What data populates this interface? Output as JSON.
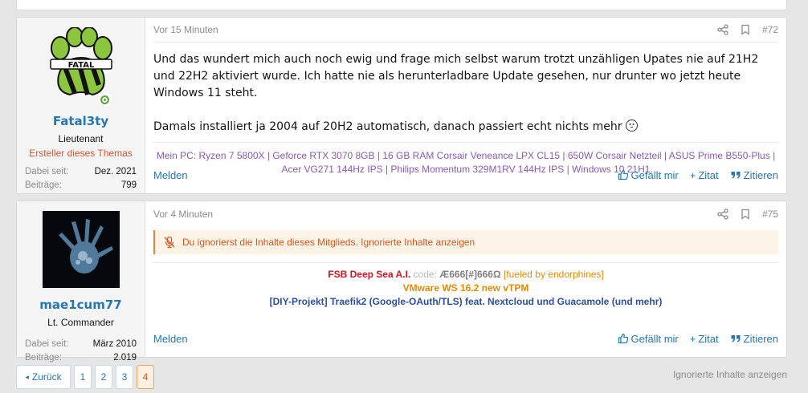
{
  "posts": [
    {
      "user": {
        "name": "Fatal3ty",
        "title": "Lieutenant",
        "banner": "Ersteller dieses Themas",
        "joined_label": "Dabei seit:",
        "joined_value": "Dez. 2021",
        "posts_label": "Beiträge:",
        "posts_value": "799",
        "online": true
      },
      "date": "Vor 15 Minuten",
      "number": "#72",
      "body": [
        "Und das wundert mich auch noch ewig und frage mich selbst warum trotzt unzähligen Upates nie auf 21H2 und 22H2 aktiviert wurde. Ich hatte nie als herunterladbare Update gesehen, nur drunter wo jetzt heute Windows 11 steht.",
        "Damals installiert ja 2004 auf 20H2 automatisch, danach passiert echt nichts mehr"
      ],
      "signature": "Mein PC: Ryzen 7 5800X | Geforce RTX 3070 8GB | 16 GB RAM Corsair Veneance LPX CL15 | 650W Corsair Netzteil | ASUS Prime B550-Plus | Acer VG271 144Hz IPS | Philips Momentum 329M1RV 144Hz IPS | Windows 10 21H1",
      "report": "Melden",
      "like": "Gefällt mir",
      "cite": "Zitat",
      "quote": "Zitieren"
    },
    {
      "user": {
        "name": "mae1cum77",
        "title": "Lt. Commander",
        "joined_label": "Dabei seit:",
        "joined_value": "März 2010",
        "posts_label": "Beiträge:",
        "posts_value": "2.019"
      },
      "date": "Vor 4 Minuten",
      "number": "#75",
      "ignore_text": "Du ignorierst die Inhalte dieses Mitglieds.",
      "ignore_link": "Ignorierte Inhalte anzeigen",
      "sig_line1_title": "FSB Deep Sea A.I.",
      "sig_line1_code_label": "code:",
      "sig_line1_code": "Æ666[#]666Ω",
      "sig_line1_tag": "[fueled by endorphines]",
      "sig_line2": "VMware WS 16.2 new vTPM",
      "sig_line3": "[DIY-Projekt] Traefik2 (Google-OAuth/TLS) feat. Nextcloud und Guacamole (und mehr)",
      "report": "Melden",
      "like": "Gefällt mir",
      "cite": "Zitat",
      "quote": "Zitieren"
    }
  ],
  "pagination": {
    "prev": "Zurück",
    "pages": [
      "1",
      "2",
      "3",
      "4"
    ],
    "current": "4"
  },
  "ignored_link": "Ignorierte Inhalte anzeigen",
  "colors": {
    "accent": "#2577b1",
    "banner": "#e0542a",
    "signature": "#8a5bb1",
    "notice": "#d9571f"
  }
}
